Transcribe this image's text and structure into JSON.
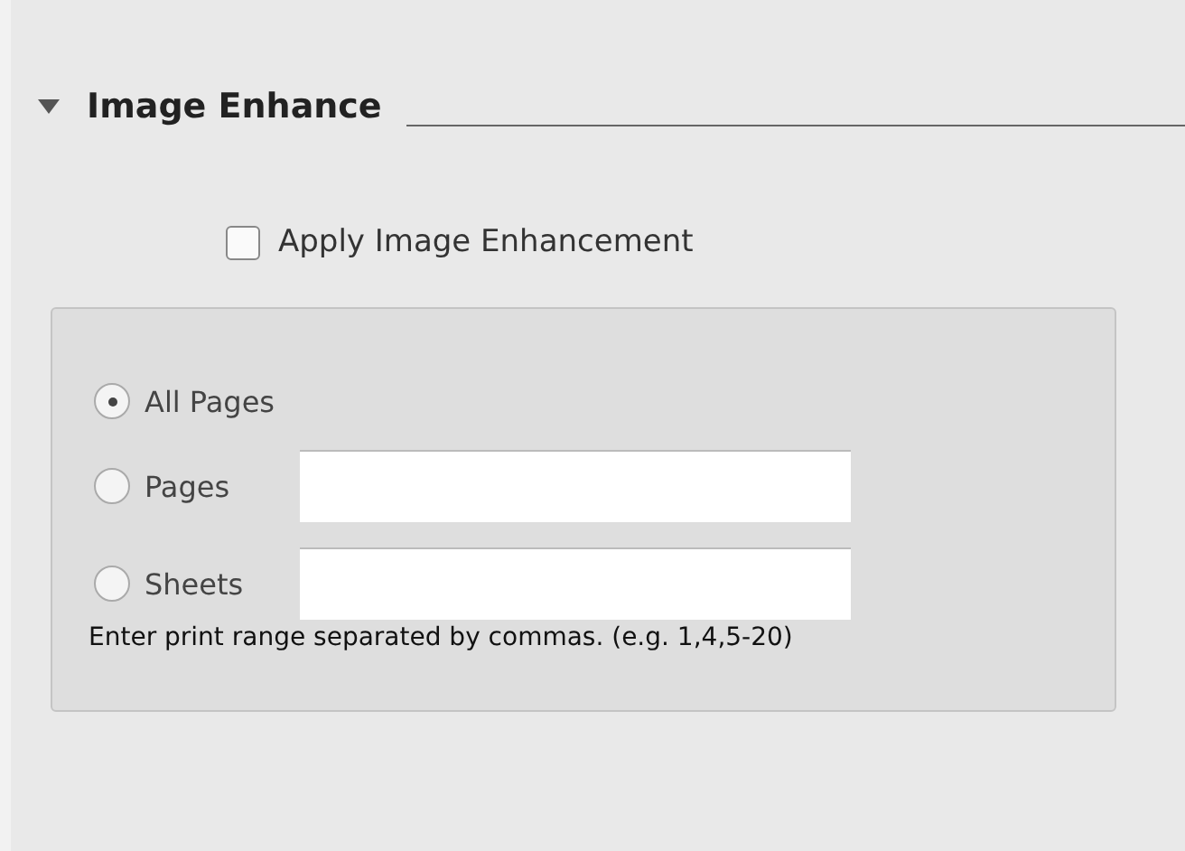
{
  "section": {
    "title": "Image Enhance",
    "expanded": true
  },
  "apply_checkbox": {
    "label": "Apply Image Enhancement",
    "checked": false
  },
  "range_options": [
    {
      "label": "All Pages",
      "selected": true
    },
    {
      "label": "Pages",
      "selected": false,
      "kind": "field"
    },
    {
      "label": "Sheets",
      "selected": false,
      "kind": "field"
    }
  ],
  "hint": "Enter print range separated by commas. (e.g. 1,4,5-20)"
}
